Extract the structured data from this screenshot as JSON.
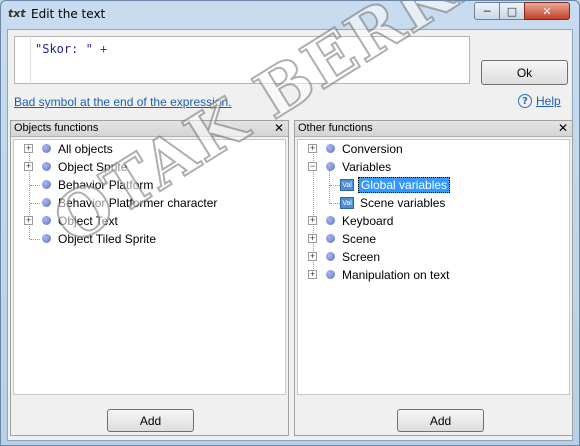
{
  "window": {
    "title": "Edit the text",
    "app_icon": "txt-icon",
    "controls": {
      "minimize": "─",
      "maximize": "□",
      "close": "✕"
    }
  },
  "editor": {
    "string_part": "\"Skor: \"",
    "operator_part": " +"
  },
  "buttons": {
    "ok": "Ok",
    "add_left": "Add",
    "add_right": "Add"
  },
  "status": {
    "error_message": "Bad symbol at the end of the expression.",
    "help_label": "Help",
    "help_icon": "?"
  },
  "objects_panel": {
    "title": "Objects functions",
    "close": "✕",
    "items": [
      {
        "label": "All objects",
        "expandable": true
      },
      {
        "label": "Object Sprite",
        "expandable": true
      },
      {
        "label": "Behavior Platform",
        "expandable": false
      },
      {
        "label": "Behavior Platformer character",
        "expandable": false
      },
      {
        "label": "Object Text",
        "expandable": true
      },
      {
        "label": "Object Tiled Sprite",
        "expandable": false
      }
    ]
  },
  "other_panel": {
    "title": "Other functions",
    "close": "✕",
    "items": [
      {
        "label": "Conversion",
        "expandable": true,
        "expanded": false
      },
      {
        "label": "Variables",
        "expandable": true,
        "expanded": true
      },
      {
        "label": "Global variables",
        "child": true,
        "selected": true,
        "icon_text": "Val"
      },
      {
        "label": "Scene variables",
        "child": true,
        "selected": false,
        "icon_text": "Val"
      },
      {
        "label": "Keyboard",
        "expandable": true,
        "expanded": false
      },
      {
        "label": "Scene",
        "expandable": true,
        "expanded": false
      },
      {
        "label": "Screen",
        "expandable": true,
        "expanded": false
      },
      {
        "label": "Manipulation on text",
        "expandable": true,
        "expanded": false
      }
    ]
  },
  "watermark": "OTAK BERKEMBANG",
  "colors": {
    "link": "#1a5fb4",
    "selection": "#3399ff",
    "string": "#1f1fa0",
    "operator": "#c01010"
  }
}
